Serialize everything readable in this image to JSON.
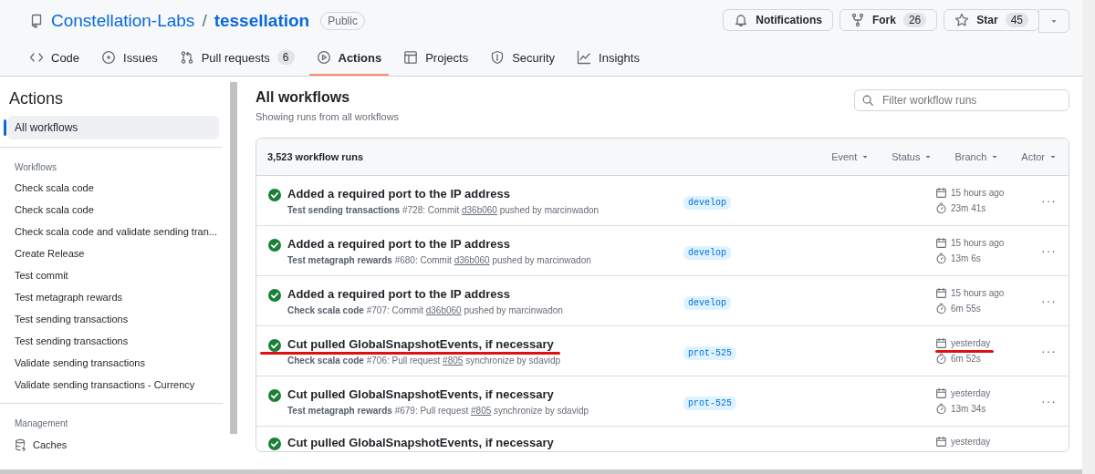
{
  "repo": {
    "owner": "Constellation-Labs",
    "separator": "/",
    "name": "tessellation",
    "visibility": "Public"
  },
  "repo_actions": [
    {
      "kind": "notifications",
      "label": "Notifications"
    },
    {
      "kind": "fork",
      "label": "Fork",
      "count": "26"
    },
    {
      "kind": "star",
      "label": "Star",
      "count": "45"
    }
  ],
  "tabs": [
    {
      "label": "Code",
      "selected": false
    },
    {
      "label": "Issues",
      "selected": false
    },
    {
      "label": "Pull requests",
      "count": "6",
      "selected": false
    },
    {
      "label": "Actions",
      "selected": true
    },
    {
      "label": "Projects",
      "selected": false
    },
    {
      "label": "Security",
      "selected": false
    },
    {
      "label": "Insights",
      "selected": false
    }
  ],
  "sidebar": {
    "title": "Actions",
    "top_item": {
      "label": "All workflows",
      "selected": true
    },
    "workflows_heading": "Workflows",
    "workflows": [
      {
        "label": "Check scala code",
        "selected": false
      },
      {
        "label": "Check scala code",
        "selected": false
      },
      {
        "label": "Check scala code and validate sending tran...",
        "selected": false
      },
      {
        "label": "Create Release",
        "selected": false
      },
      {
        "label": "Test commit",
        "selected": false
      },
      {
        "label": "Test metagraph rewards",
        "selected": false
      },
      {
        "label": "Test sending transactions",
        "selected": false
      },
      {
        "label": "Test sending transactions",
        "selected": false
      },
      {
        "label": "Validate sending transactions",
        "selected": false
      },
      {
        "label": "Validate sending transactions - Currency",
        "selected": false
      }
    ],
    "management_heading": "Management",
    "management": [
      {
        "label": "Caches"
      }
    ]
  },
  "main": {
    "title": "All workflows",
    "subtitle": "Showing runs from all workflows",
    "filter": {
      "placeholder": "Filter workflow runs"
    }
  },
  "runs_table": {
    "count": "3,523 workflow runs",
    "filters": [
      "Event",
      "Status",
      "Branch",
      "Actor"
    ],
    "runs": [
      {
        "title": "Added a required port to the IP address",
        "meta_before": "**Test sending transactions** #728: Commit",
        "meta_link": "d36b060",
        "meta_after": "pushed by marcinwadon",
        "branch": "develop",
        "date": "15 hours ago",
        "duration": "23m 41s",
        "more": "···",
        "underlined": false
      },
      {
        "title": "Added a required port to the IP address",
        "meta_before": "**Test metagraph rewards** #680: Commit",
        "meta_link": "d36b060",
        "meta_after": "pushed by marcinwadon",
        "branch": "develop",
        "date": "15 hours ago",
        "duration": "13m 6s",
        "more": "···",
        "underlined": false
      },
      {
        "title": "Added a required port to the IP address",
        "meta_before": "**Check scala code** #707: Commit",
        "meta_link": "d36b060",
        "meta_after": "pushed by marcinwadon",
        "branch": "develop",
        "date": "15 hours ago",
        "duration": "6m 55s",
        "more": "···",
        "underlined": false
      },
      {
        "title": "Cut pulled GlobalSnapshotEvents, if necessary",
        "meta_before": "**Check scala code** #706: Pull request",
        "meta_link": "#805",
        "meta_after": "synchronize by sdavidp",
        "branch": "prot-525",
        "date": "yesterday",
        "duration": "6m 52s",
        "more": "···",
        "underlined": true
      },
      {
        "title": "Cut pulled GlobalSnapshotEvents, if necessary",
        "meta_before": "**Test metagraph rewards** #679: Pull request",
        "meta_link": "#805",
        "meta_after": "synchronize by sdavidp",
        "branch": "prot-525",
        "date": "yesterday",
        "duration": "13m 34s",
        "more": "···",
        "underlined": false
      },
      {
        "title": "Cut pulled GlobalSnapshotEvents, if necessary",
        "date": "yesterday",
        "underlined": false
      }
    ]
  }
}
